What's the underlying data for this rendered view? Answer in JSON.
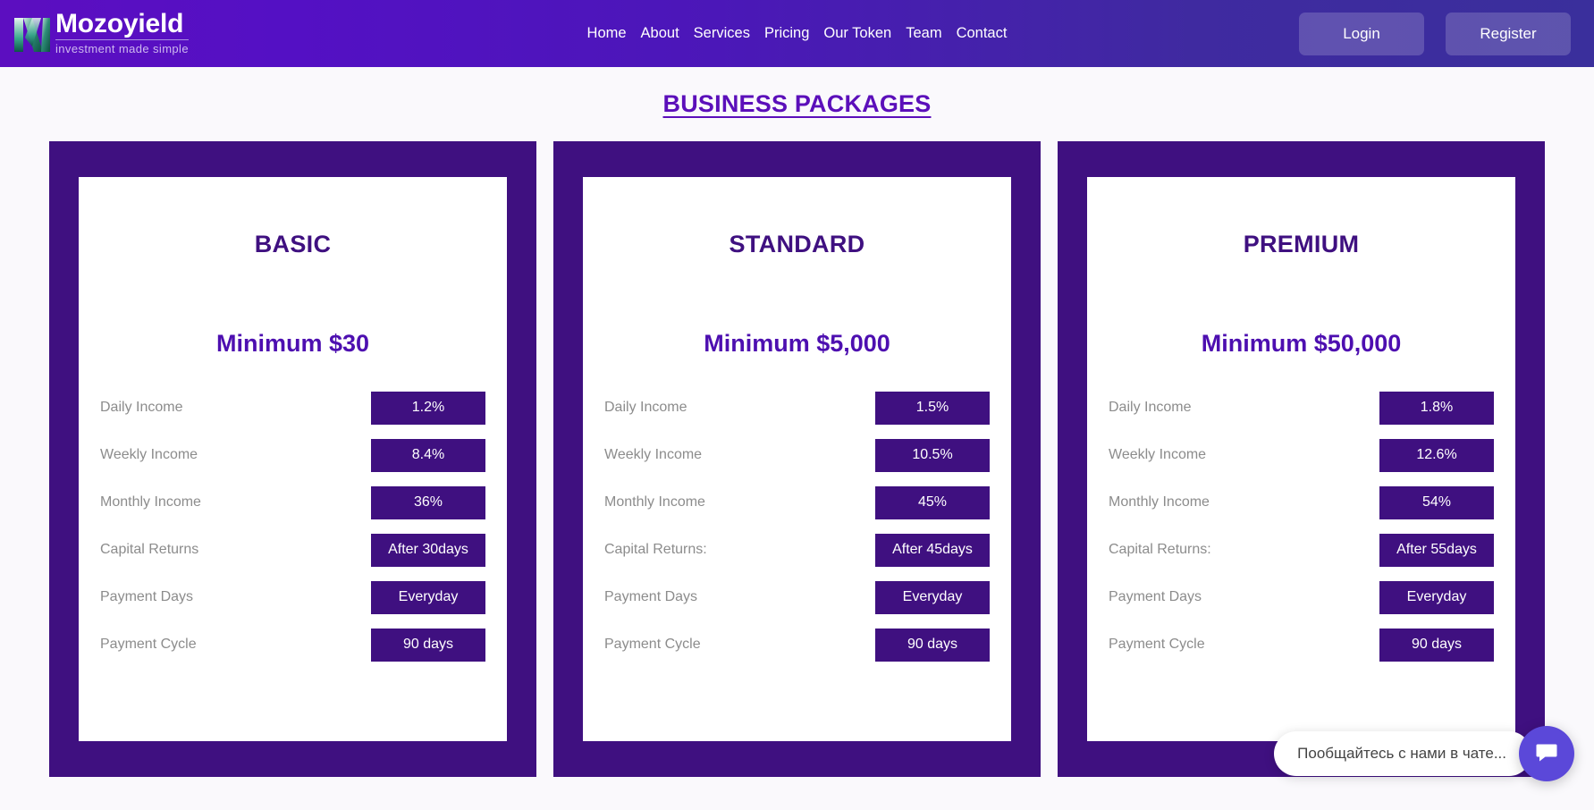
{
  "header": {
    "brand": {
      "name": "Mozoyield",
      "tagline": "investment made simple",
      "logo_icon": "mozoyield-m-logo-icon"
    },
    "nav": [
      {
        "label": "Home"
      },
      {
        "label": "About"
      },
      {
        "label": "Services"
      },
      {
        "label": "Pricing"
      },
      {
        "label": "Our Token"
      },
      {
        "label": "Team"
      },
      {
        "label": "Contact"
      }
    ],
    "login_label": "Login",
    "register_label": "Register",
    "gradient_from": "#5c0ec0",
    "gradient_to": "#3a2f9c"
  },
  "main": {
    "title": "BUSINESS PACKAGES",
    "title_color": "#5b0fba",
    "cards": [
      {
        "plan": "BASIC",
        "minimum": "Minimum $30",
        "rows": [
          {
            "label": "Daily Income",
            "value": "1.2%"
          },
          {
            "label": "Weekly Income",
            "value": "8.4%"
          },
          {
            "label": "Monthly Income",
            "value": "36%"
          },
          {
            "label": "Capital Returns",
            "value": "After 30days"
          },
          {
            "label": "Payment Days",
            "value": "Everyday"
          },
          {
            "label": "Payment Cycle",
            "value": "90 days"
          }
        ]
      },
      {
        "plan": "STANDARD",
        "minimum": "Minimum $5,000",
        "rows": [
          {
            "label": "Daily Income",
            "value": "1.5%"
          },
          {
            "label": "Weekly Income",
            "value": "10.5%"
          },
          {
            "label": "Monthly Income",
            "value": "45%"
          },
          {
            "label": "Capital Returns:",
            "value": "After 45days"
          },
          {
            "label": "Payment Days",
            "value": "Everyday"
          },
          {
            "label": "Payment Cycle",
            "value": "90 days"
          }
        ]
      },
      {
        "plan": "PREMIUM",
        "minimum": "Minimum $50,000",
        "rows": [
          {
            "label": "Daily Income",
            "value": "1.8%"
          },
          {
            "label": "Weekly Income",
            "value": "12.6%"
          },
          {
            "label": "Monthly Income",
            "value": "54%"
          },
          {
            "label": "Capital Returns:",
            "value": "After 55days"
          },
          {
            "label": "Payment Days",
            "value": "Everyday"
          },
          {
            "label": "Payment Cycle",
            "value": "90 days"
          }
        ]
      }
    ],
    "card_bg": "#3f1080",
    "badge_bg": "#3f1080"
  },
  "chat": {
    "prompt": "Пообщайтесь с нами в чате...",
    "launcher_icon": "chat-bubble-icon",
    "launcher_color": "#5b48d9"
  }
}
